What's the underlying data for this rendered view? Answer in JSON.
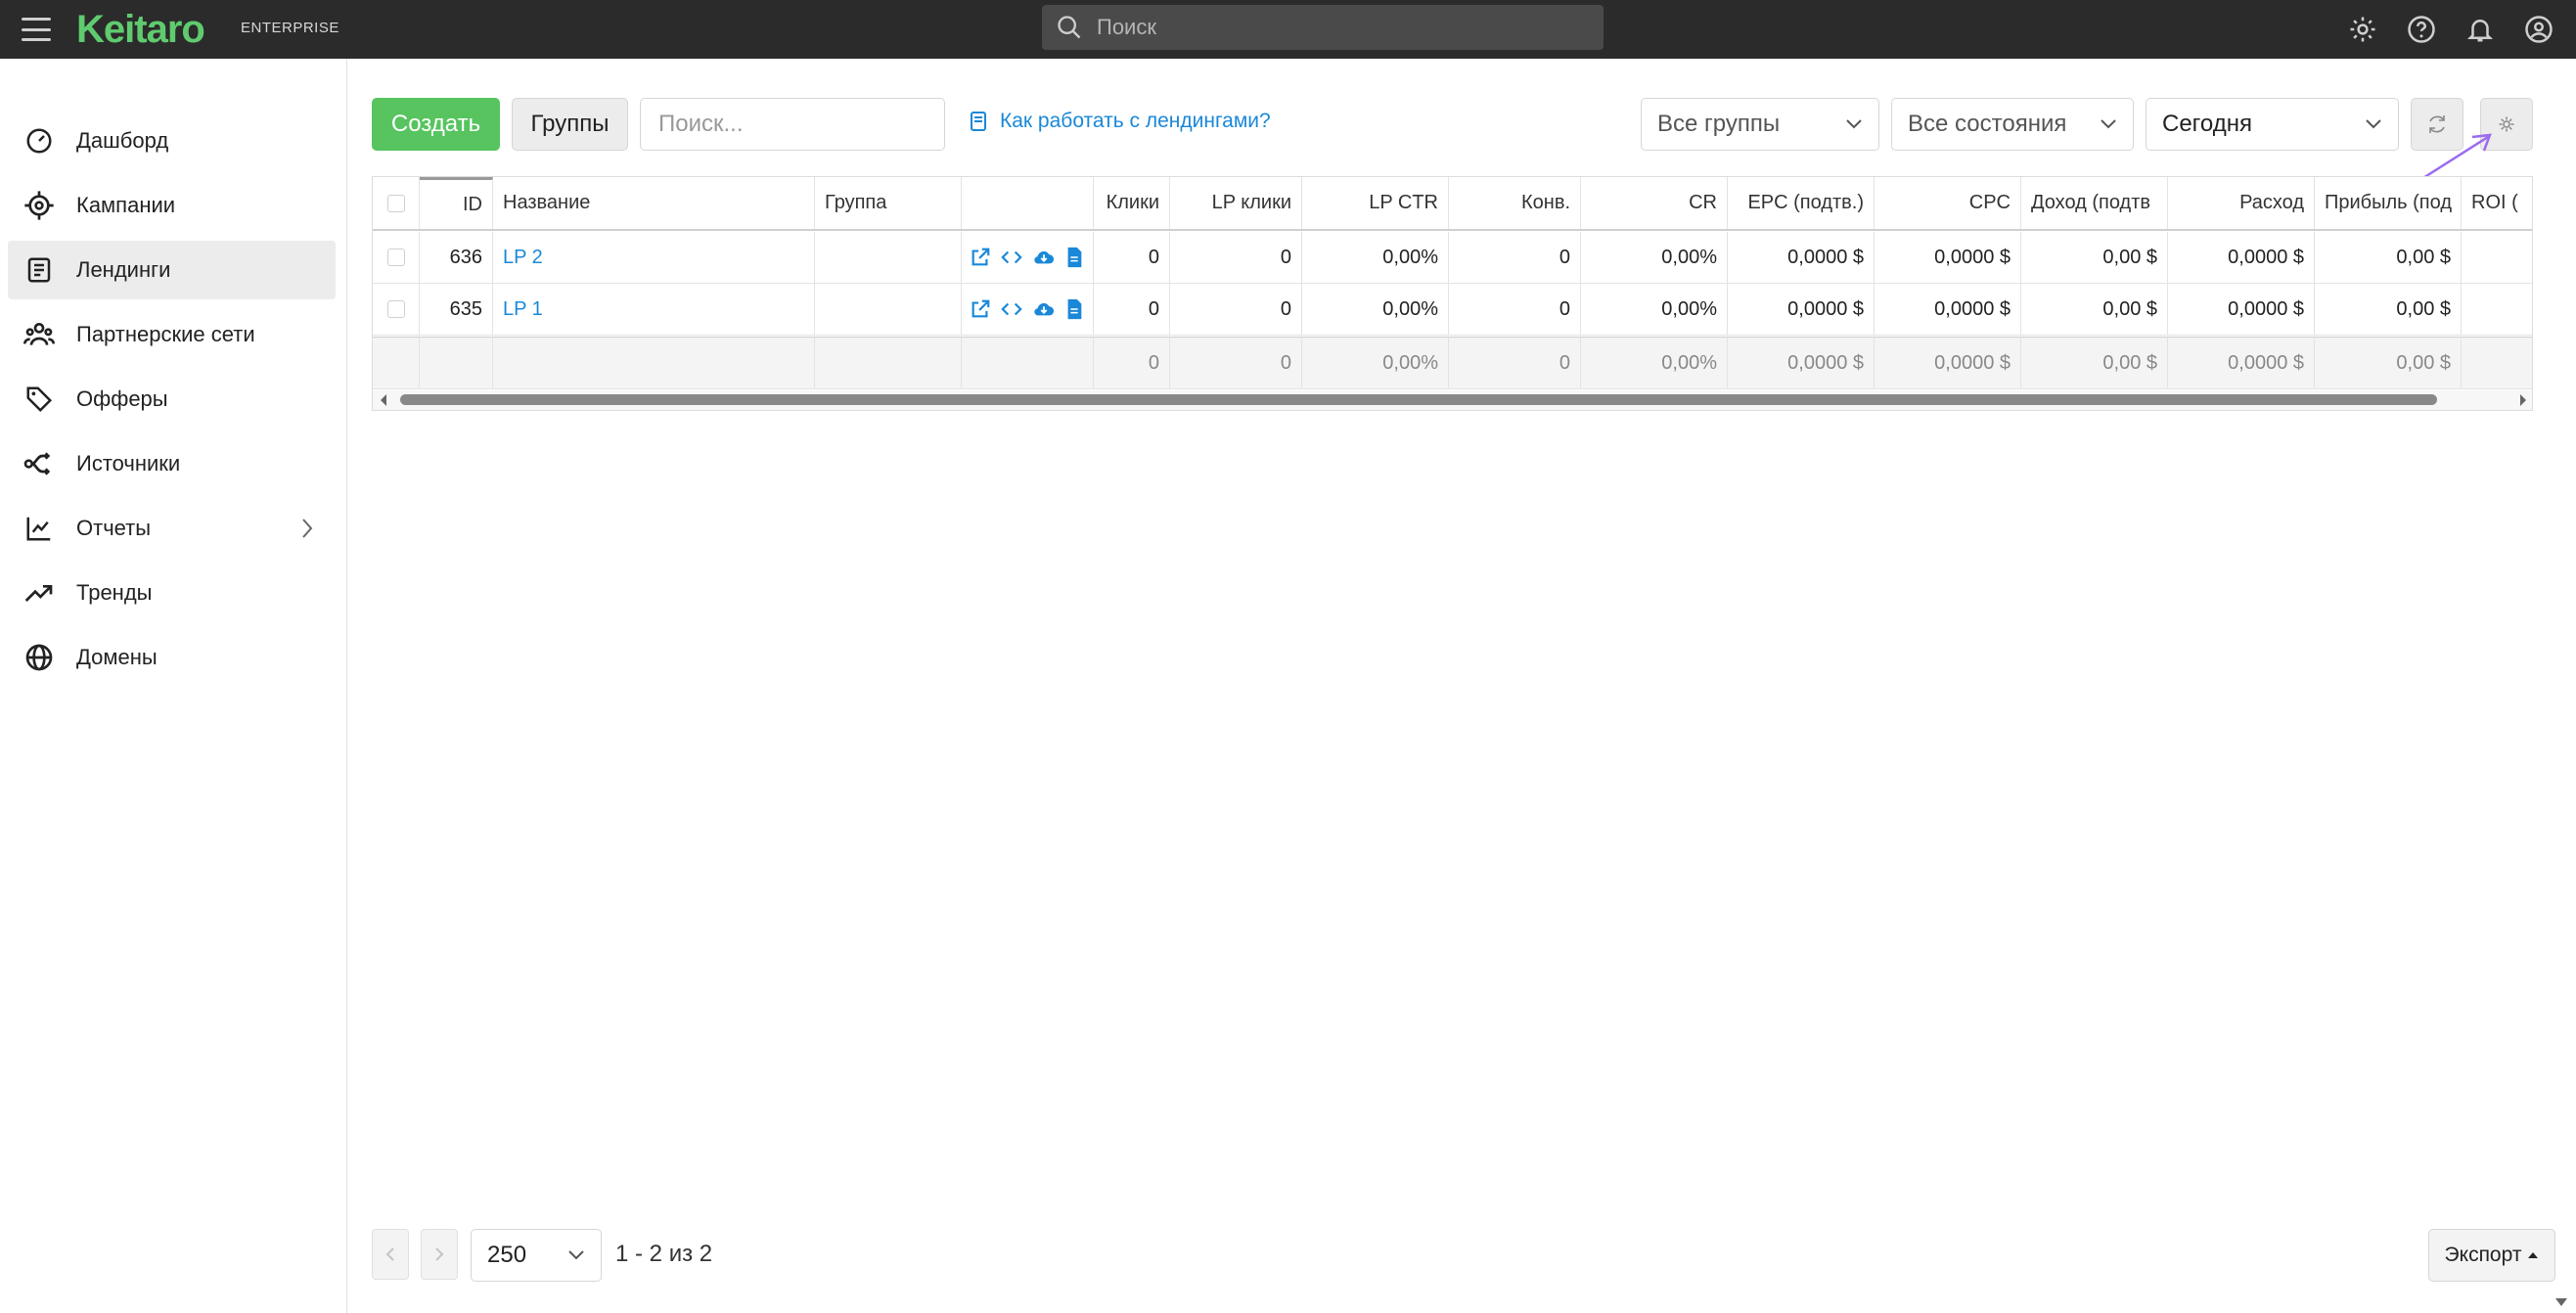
{
  "app": {
    "logo": "Keitaro",
    "edition": "ENTERPRISE"
  },
  "topbar": {
    "search_placeholder": "Поиск"
  },
  "sidebar": {
    "items": [
      {
        "label": "Дашборд",
        "icon": "dashboard-icon"
      },
      {
        "label": "Кампании",
        "icon": "target-icon"
      },
      {
        "label": "Лендинги",
        "icon": "document-icon",
        "active": true
      },
      {
        "label": "Партнерские сети",
        "icon": "people-icon"
      },
      {
        "label": "Офферы",
        "icon": "tags-icon"
      },
      {
        "label": "Источники",
        "icon": "route-icon"
      },
      {
        "label": "Отчеты",
        "icon": "chart-icon",
        "has_submenu": true
      },
      {
        "label": "Тренды",
        "icon": "trending-icon"
      },
      {
        "label": "Домены",
        "icon": "globe-icon"
      }
    ]
  },
  "toolbar": {
    "create_label": "Создать",
    "groups_label": "Группы",
    "search_placeholder": "Поиск...",
    "help_link": "Как работать с лендингами?",
    "filter_groups": "Все группы",
    "filter_states": "Все состояния",
    "filter_date": "Сегодня"
  },
  "table": {
    "columns": [
      "ID",
      "Название",
      "Группа",
      "",
      "Клики",
      "LP клики",
      "LP CTR",
      "Конв.",
      "CR",
      "EPC (подтв.)",
      "CPC",
      "Доход (подтв",
      "Расход",
      "Прибыль (под",
      "ROI ("
    ],
    "rows": [
      {
        "id": "636",
        "name": "LP 2",
        "group": "",
        "clicks": "0",
        "lp_clicks": "0",
        "lp_ctr": "0,00%",
        "conv": "0",
        "cr": "0,00%",
        "epc": "0,0000 $",
        "cpc": "0,0000 $",
        "revenue": "0,00 $",
        "cost": "0,0000 $",
        "profit": "0,00 $"
      },
      {
        "id": "635",
        "name": "LP 1",
        "group": "",
        "clicks": "0",
        "lp_clicks": "0",
        "lp_ctr": "0,00%",
        "conv": "0",
        "cr": "0,00%",
        "epc": "0,0000 $",
        "cpc": "0,0000 $",
        "revenue": "0,00 $",
        "cost": "0,0000 $",
        "profit": "0,00 $"
      }
    ],
    "totals": {
      "clicks": "0",
      "lp_clicks": "0",
      "lp_ctr": "0,00%",
      "conv": "0",
      "cr": "0,00%",
      "epc": "0,0000 $",
      "cpc": "0,0000 $",
      "revenue": "0,00 $",
      "cost": "0,0000 $",
      "profit": "0,00 $"
    }
  },
  "pagination": {
    "page_size": "250",
    "info": "1 - 2 из 2"
  },
  "export_label": "Экспорт",
  "colors": {
    "accent": "#57c45f",
    "link": "#1a88d8",
    "topbar": "#2b2b2b",
    "annotation_arrow": "#9b6bf0"
  }
}
